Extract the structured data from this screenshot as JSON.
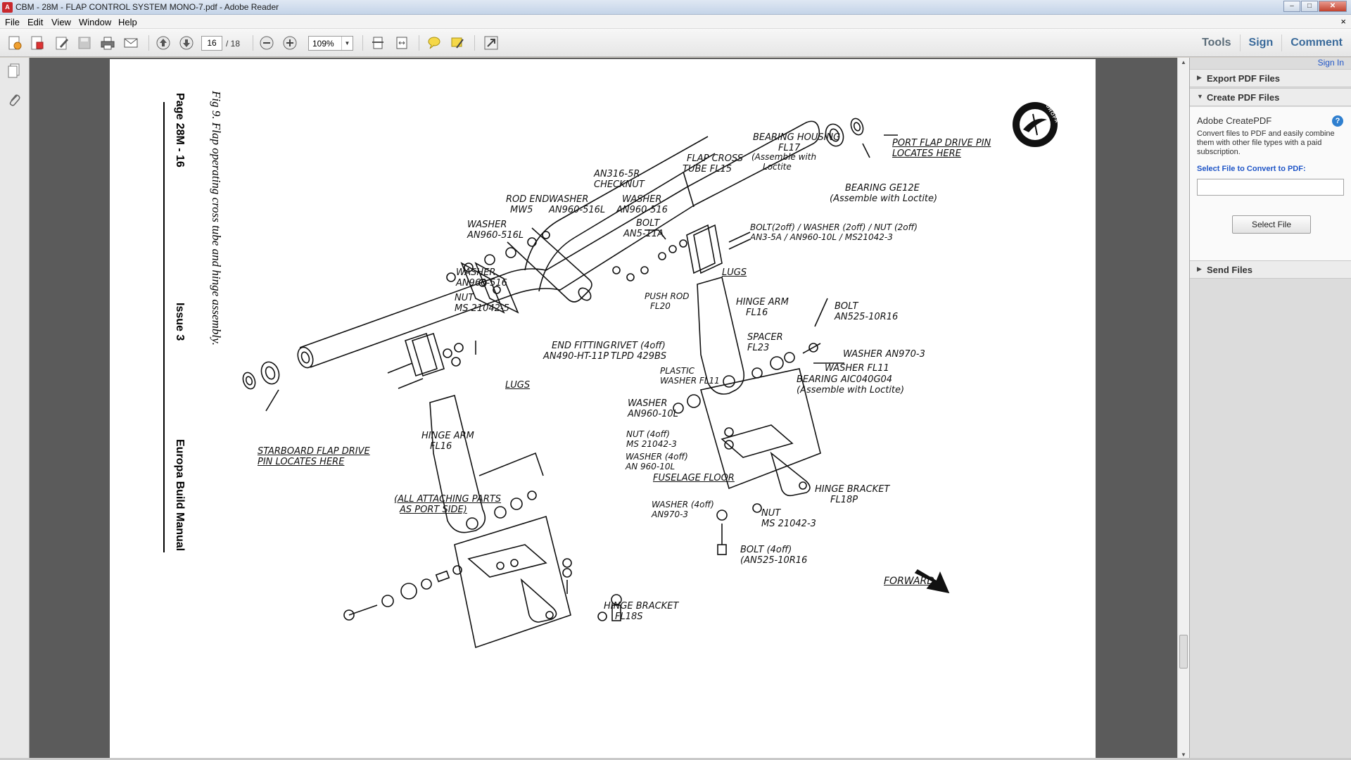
{
  "window": {
    "title": "CBM - 28M - FLAP CONTROL SYSTEM MONO-7.pdf - Adobe Reader",
    "min_label": "‒",
    "max_label": "□",
    "close_label": "✕"
  },
  "menu": {
    "items": [
      "File",
      "Edit",
      "View",
      "Window",
      "Help"
    ],
    "close": "×"
  },
  "toolbar": {
    "page_current": "16",
    "page_total": "/ 18",
    "zoom": "109%",
    "right_tools": [
      "Tools",
      "Sign",
      "Comment"
    ]
  },
  "document": {
    "fig_caption": "Fig 9. Flap operating cross tube and hinge assembly.",
    "page_label": "Page 28M - 16",
    "issue_label": "Issue 3",
    "manual_label": "Europa Build Manual",
    "logo_text": "EUROPA",
    "forward_label": "FORWARD",
    "callouts": {
      "bearing_housing": [
        "BEARING HOUSING",
        "FL17",
        "(Assemble with",
        "Loctite"
      ],
      "port_pin": [
        "PORT FLAP DRIVE PIN",
        "LOCATES HERE"
      ],
      "flap_tube": [
        "FLAP CROSS",
        "TUBE  FL15"
      ],
      "bearing_ge": [
        "BEARING GE12E",
        "(Assemble with Loctite)"
      ],
      "an316": [
        "AN316-5R",
        "CHECKNUT"
      ],
      "rod_end": [
        "ROD END",
        "MW5"
      ],
      "washer_an960_516l_a": [
        "WASHER",
        "AN960-516L"
      ],
      "washer_an960_516_a": [
        "WASHER",
        "AN960-516"
      ],
      "bolt_an5": [
        "BOLT",
        "AN5-11A"
      ],
      "washer_an960_516l_b": [
        "WASHER",
        "AN960-516L"
      ],
      "bolt_2off": [
        "BOLT(2off) / WASHER (2off) / NUT (2off)",
        "AN3-5A  /  AN960-10L  /  MS21042-3"
      ],
      "washer_an960_516_b": [
        "WASHER",
        "AN960-516"
      ],
      "nut_ms": [
        "NUT",
        "MS 21042-5"
      ],
      "lugs_right": "LUGS",
      "push_rod": [
        "PUSH ROD",
        "FL20"
      ],
      "hinge_arm_right": [
        "HINGE ARM",
        "FL16"
      ],
      "bolt_an525_right": [
        "BOLT",
        "AN525-10R16"
      ],
      "end_fitting": [
        "END FITTING",
        "AN490-HT-11P"
      ],
      "rivet": [
        "RIVET (4off)",
        "TLPD 429BS"
      ],
      "spacer": [
        "SPACER",
        "FL23"
      ],
      "washer_an970_3": "WASHER AN970-3",
      "washer_fl11": "WASHER FL11",
      "lugs_left": "LUGS",
      "plastic_washer": [
        "PLASTIC",
        "WASHER FL11"
      ],
      "bearing_aic": [
        "BEARING AIC040G04",
        "(Assemble with Loctite)"
      ],
      "washer_an960_10l": [
        "WASHER",
        "AN960-10L"
      ],
      "starboard_pin": [
        "STARBOARD FLAP DRIVE",
        "PIN LOCATES HERE"
      ],
      "hinge_arm_left": [
        "HINGE ARM",
        "FL16"
      ],
      "nut_4off": [
        "NUT (4off)",
        "MS 21042-3"
      ],
      "washer_4off": [
        "WASHER (4off)",
        "AN 960-10L"
      ],
      "fuselage_floor": "FUSELAGE FLOOR",
      "hinge_bracket_p": [
        "HINGE BRACKET",
        "FL18P"
      ],
      "all_parts": [
        "(ALL ATTACHING PARTS",
        "AS PORT SIDE)"
      ],
      "washer_an970_4off": [
        "WASHER (4off)",
        "AN970-3"
      ],
      "nut_ms21042_3": [
        "NUT",
        "MS 21042-3"
      ],
      "bolt_4off": [
        "BOLT (4off)",
        "(AN525-10R16"
      ],
      "hinge_bracket_s": [
        "HINGE BRACKET",
        "FL18S"
      ]
    }
  },
  "right_panel": {
    "sign_in": "Sign In",
    "export_pdf": "Export PDF Files",
    "create_pdf": "Create PDF Files",
    "createpdf_title": "Adobe CreatePDF",
    "createpdf_desc": "Convert files to PDF and easily combine them with other file types with a paid subscription.",
    "select_file_link": "Select File to Convert to PDF:",
    "select_file_btn": "Select File",
    "send_files": "Send Files"
  },
  "colors": {
    "accent_blue": "#1f55c7",
    "doc_background": "#5b5b5b"
  }
}
